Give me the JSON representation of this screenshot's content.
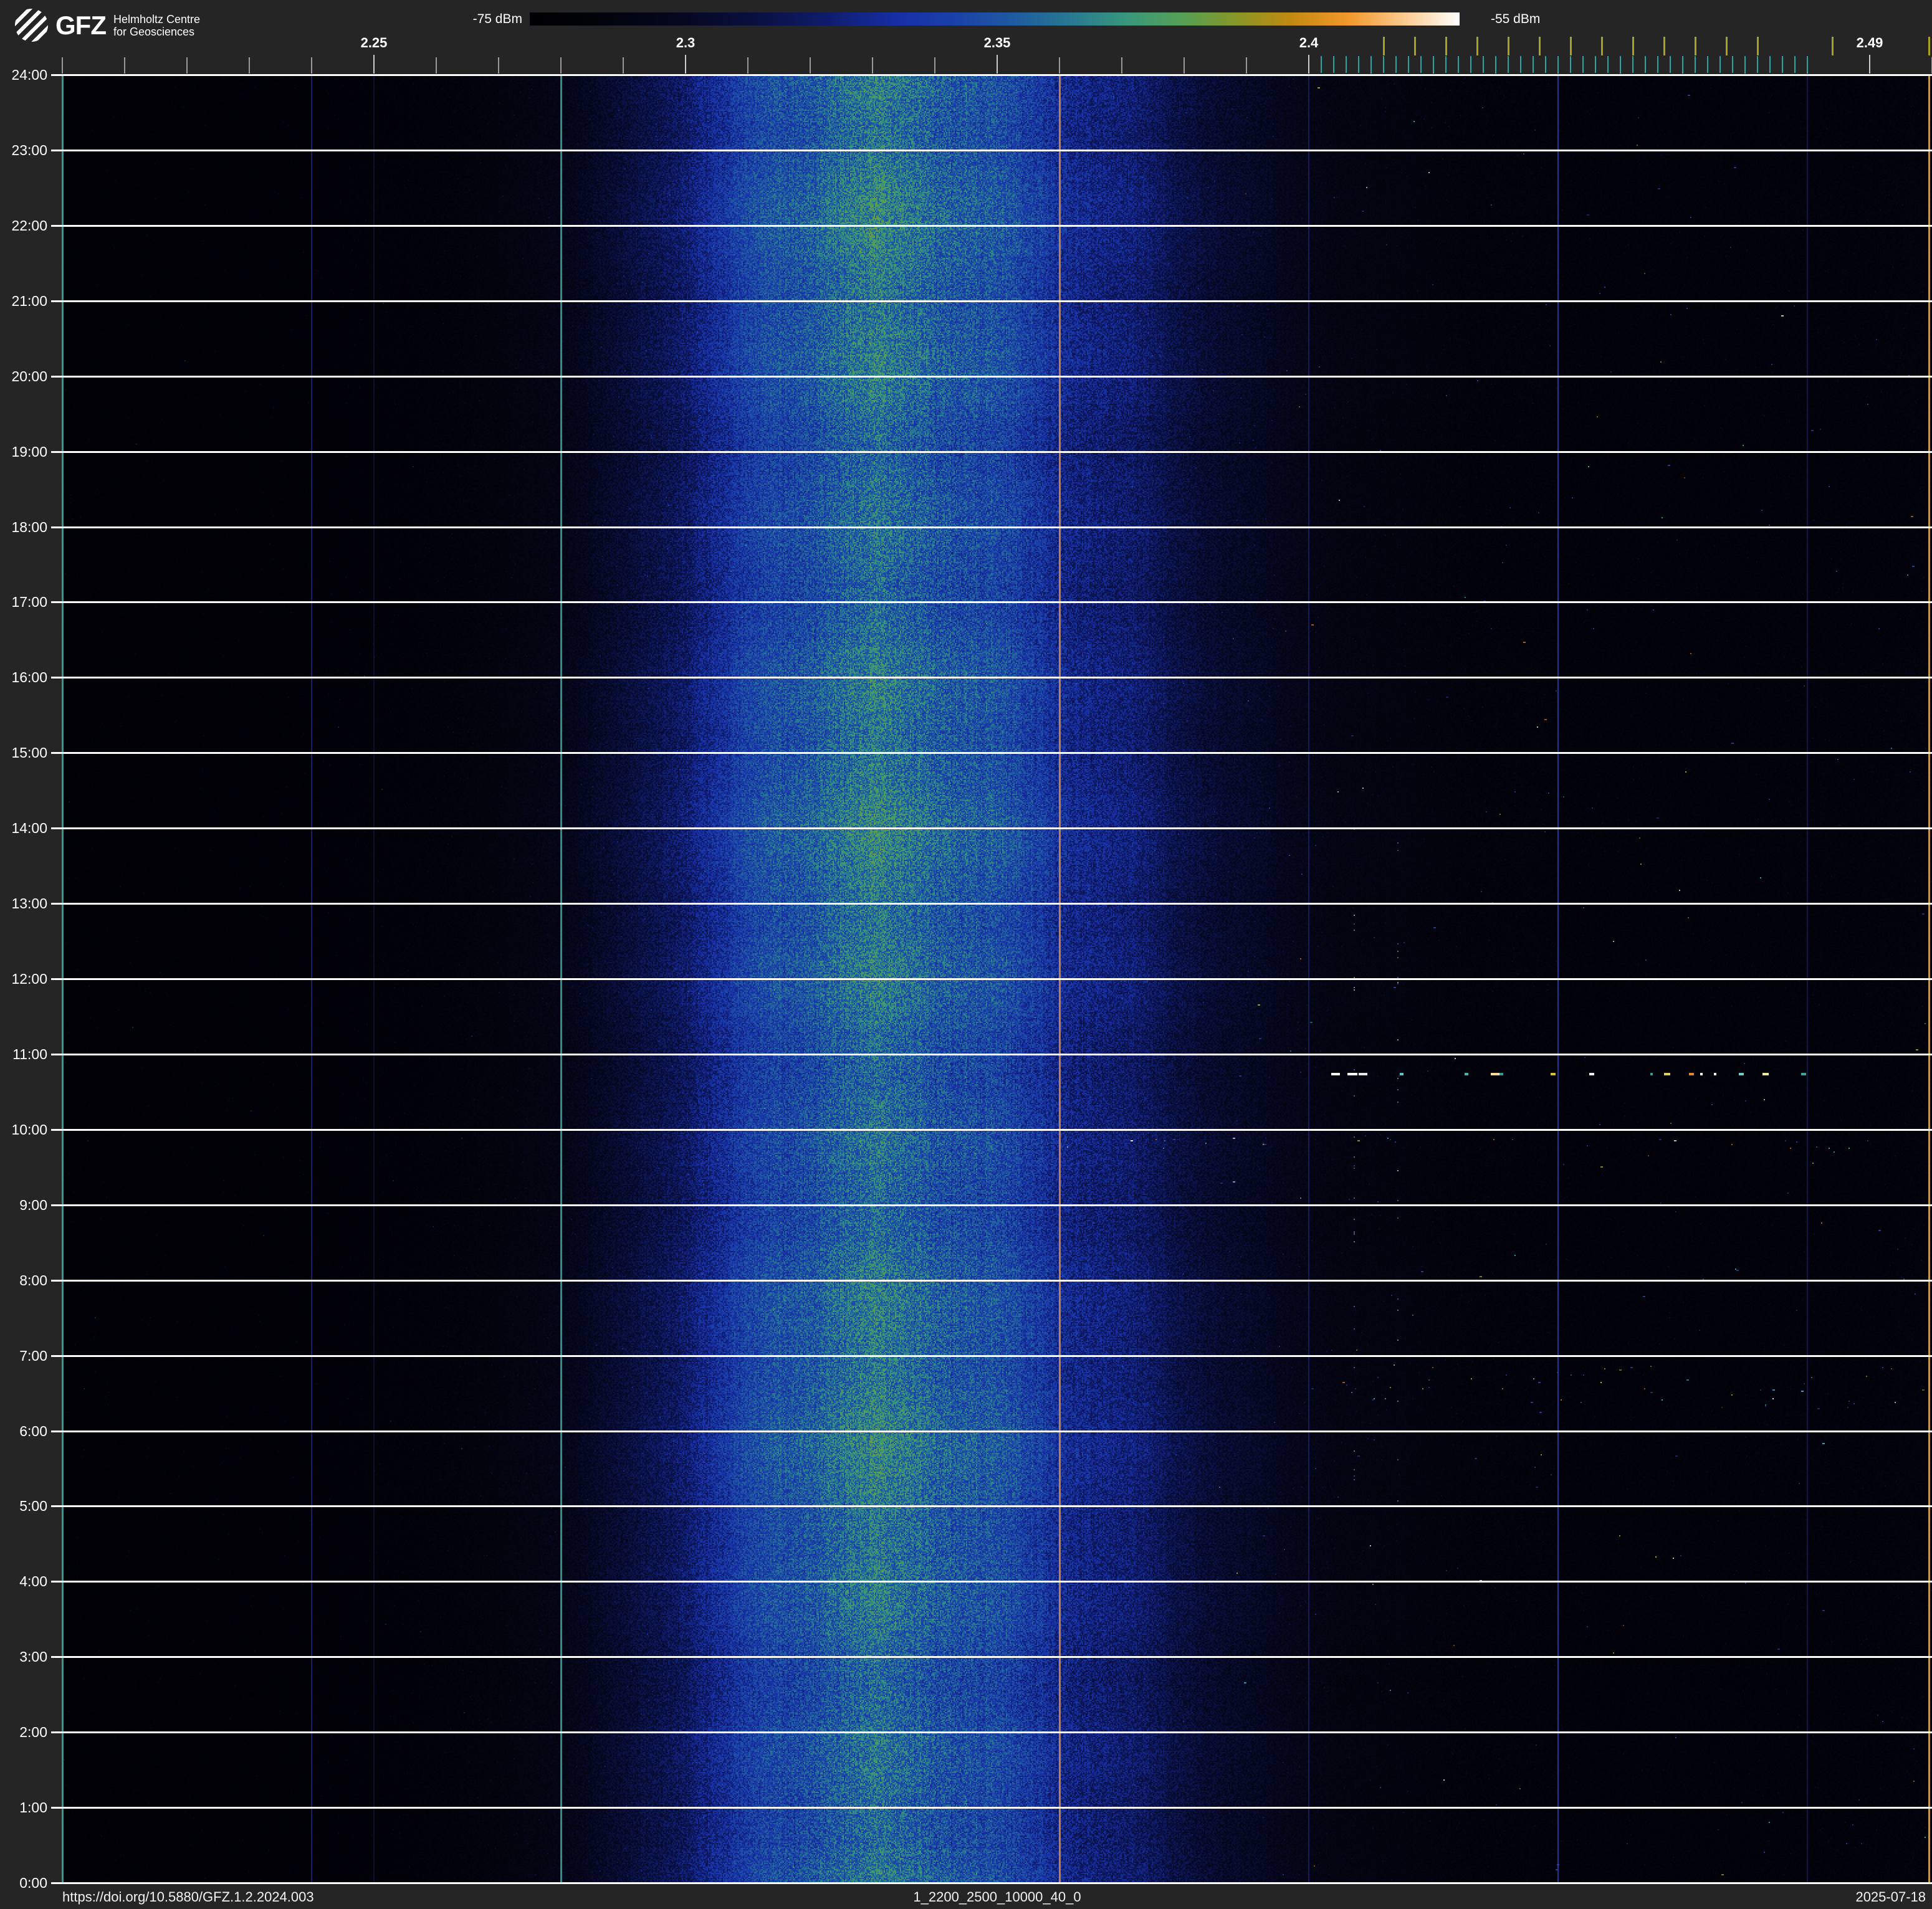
{
  "meta": {
    "bg": "#252525",
    "plot_bg": "#000003"
  },
  "header": {
    "logo": {
      "org": "GFZ",
      "sub1": "Helmholtz Centre",
      "sub2": "for Geosciences"
    },
    "colorbar": {
      "min_label": "-75 dBm",
      "max_label": "-55 dBm"
    }
  },
  "footer": {
    "doi": "https://doi.org/10.5880/GFZ.1.2.2024.003",
    "dataset_id": "1_2200_2500_10000_40_0",
    "date": "2025-07-18"
  },
  "chart_data": {
    "type": "heatmap",
    "x_axis": {
      "unit": "MHz",
      "min": 2.2,
      "max": 2.5,
      "minor_tick_step": 0.01,
      "labeled_ticks": [
        2.25,
        2.3,
        2.35,
        2.4,
        2.49
      ],
      "labels": [
        "2.25",
        "2.3",
        "2.35",
        "2.4",
        "2.49"
      ]
    },
    "y_axis": {
      "unit": "time of day",
      "top": "24:00",
      "bottom": "0:00",
      "hours": 24,
      "labels": [
        "24:00",
        "23:00",
        "22:00",
        "21:00",
        "20:00",
        "19:00",
        "18:00",
        "17:00",
        "16:00",
        "15:00",
        "14:00",
        "13:00",
        "12:00",
        "11:00",
        "10:00",
        "9:00",
        "8:00",
        "7:00",
        "6:00",
        "5:00",
        "4:00",
        "3:00",
        "2:00",
        "1:00",
        "0:00"
      ]
    },
    "power_scale": {
      "min_dbm": -75,
      "max_dbm": -55
    },
    "colormap_stops": [
      [
        0.0,
        [
          0,
          0,
          3
        ]
      ],
      [
        0.08,
        [
          2,
          3,
          12
        ]
      ],
      [
        0.16,
        [
          5,
          7,
          30
        ]
      ],
      [
        0.24,
        [
          9,
          15,
          62
        ]
      ],
      [
        0.32,
        [
          15,
          28,
          108
        ]
      ],
      [
        0.4,
        [
          23,
          48,
          168
        ]
      ],
      [
        0.46,
        [
          27,
          66,
          168
        ]
      ],
      [
        0.52,
        [
          31,
          90,
          160
        ]
      ],
      [
        0.58,
        [
          40,
          120,
          146
        ]
      ],
      [
        0.64,
        [
          55,
          150,
          124
        ]
      ],
      [
        0.7,
        [
          85,
          160,
          88
        ]
      ],
      [
        0.76,
        [
          135,
          150,
          38
        ]
      ],
      [
        0.82,
        [
          195,
          138,
          16
        ]
      ],
      [
        0.88,
        [
          242,
          152,
          42
        ]
      ],
      [
        0.94,
        [
          251,
          202,
          142
        ]
      ],
      [
        1.0,
        [
          255,
          255,
          255
        ]
      ]
    ],
    "channel_ticks": {
      "cyan": {
        "color": "#2aa49e",
        "start": 2.402,
        "end": 2.48,
        "step": 0.002
      },
      "yellow": {
        "color": "#a8a31f",
        "start": 2.412,
        "end": 2.472,
        "step": 0.005,
        "extra": [
          2.484,
          2.4995
        ]
      }
    },
    "marker_lines": [
      {
        "freq": 2.2,
        "color": "rgba(45,162,152,0.95)",
        "w": 3
      },
      {
        "freq": 2.24,
        "color": "rgba(28,38,118,0.85)",
        "w": 2
      },
      {
        "freq": 2.25,
        "color": "rgba(28,38,118,0.40)",
        "w": 2
      },
      {
        "freq": 2.28,
        "color": "rgba(45,158,150,0.90)",
        "w": 3
      },
      {
        "freq": 2.36,
        "color": "rgba(206,130,58,0.95)",
        "w": 3
      },
      {
        "freq": 2.4,
        "color": "rgba(28,38,118,0.70)",
        "w": 2
      },
      {
        "freq": 2.44,
        "color": "rgba(48,72,200,0.75)",
        "w": 2
      },
      {
        "freq": 2.48,
        "color": "rgba(28,38,118,0.55)",
        "w": 2
      },
      {
        "freq": 2.4995,
        "color": "rgba(214,166,82,0.90)",
        "w": 3
      }
    ],
    "band_profile": [
      [
        2.2,
        0.03
      ],
      [
        2.22,
        0.032
      ],
      [
        2.24,
        0.04
      ],
      [
        2.255,
        0.055
      ],
      [
        2.27,
        0.085
      ],
      [
        2.28,
        0.125
      ],
      [
        2.29,
        0.2
      ],
      [
        2.3,
        0.3
      ],
      [
        2.308,
        0.39
      ],
      [
        2.316,
        0.47
      ],
      [
        2.324,
        0.53
      ],
      [
        2.332,
        0.56
      ],
      [
        2.34,
        0.55
      ],
      [
        2.348,
        0.505
      ],
      [
        2.356,
        0.44
      ],
      [
        2.364,
        0.37
      ],
      [
        2.372,
        0.305
      ],
      [
        2.38,
        0.24
      ],
      [
        2.388,
        0.18
      ],
      [
        2.396,
        0.13
      ],
      [
        2.404,
        0.1
      ],
      [
        2.412,
        0.085
      ],
      [
        2.43,
        0.072
      ],
      [
        2.45,
        0.065
      ],
      [
        2.47,
        0.062
      ],
      [
        2.485,
        0.065
      ],
      [
        2.5,
        0.068
      ]
    ],
    "events": {
      "dash_row_time": 10.73,
      "dashes": [
        {
          "f": 2.4035,
          "w": 14,
          "c": "#f5f5f0"
        },
        {
          "f": 2.4062,
          "w": 16,
          "c": "#ffffff"
        },
        {
          "f": 2.408,
          "w": 13,
          "c": "#e8e8e8"
        },
        {
          "f": 2.4147,
          "w": 6,
          "c": "#58c8c8"
        },
        {
          "f": 2.4249,
          "w": 5,
          "c": "#40b8b0"
        },
        {
          "f": 2.4292,
          "w": 16,
          "c": "#ffd9a0"
        },
        {
          "f": 2.4306,
          "w": 5,
          "c": "#2fa098"
        },
        {
          "f": 2.4389,
          "w": 7,
          "c": "#d8c030"
        },
        {
          "f": 2.445,
          "w": 8,
          "c": "#e8f0f0"
        },
        {
          "f": 2.4549,
          "w": 4,
          "c": "#30a098"
        },
        {
          "f": 2.4569,
          "w": 10,
          "c": "#e0d060"
        },
        {
          "f": 2.4609,
          "w": 7,
          "c": "#e08830"
        },
        {
          "f": 2.4628,
          "w": 4,
          "c": "#ffffff"
        },
        {
          "f": 2.465,
          "w": 4,
          "c": "#f0f0f0"
        },
        {
          "f": 2.4689,
          "w": 7,
          "c": "#70d0d0"
        },
        {
          "f": 2.4728,
          "w": 10,
          "c": "#f0e8a0"
        },
        {
          "f": 2.4791,
          "w": 7,
          "c": "#38a8a0"
        }
      ],
      "speck_bands": [
        {
          "t0": 6.3,
          "t1": 6.9,
          "f0": 2.405,
          "f1": 2.495,
          "n": 45
        },
        {
          "t0": 9.74,
          "t1": 9.9,
          "f0": 2.36,
          "f1": 2.49,
          "n": 28
        }
      ],
      "speck_columns": [
        {
          "f": 2.4072,
          "t0": 5,
          "t1": 14,
          "n": 26
        },
        {
          "f": 2.4143,
          "t0": 5,
          "t1": 14,
          "n": 22
        }
      ],
      "random_specks": {
        "right_n": 260,
        "left_n": 24
      }
    }
  }
}
